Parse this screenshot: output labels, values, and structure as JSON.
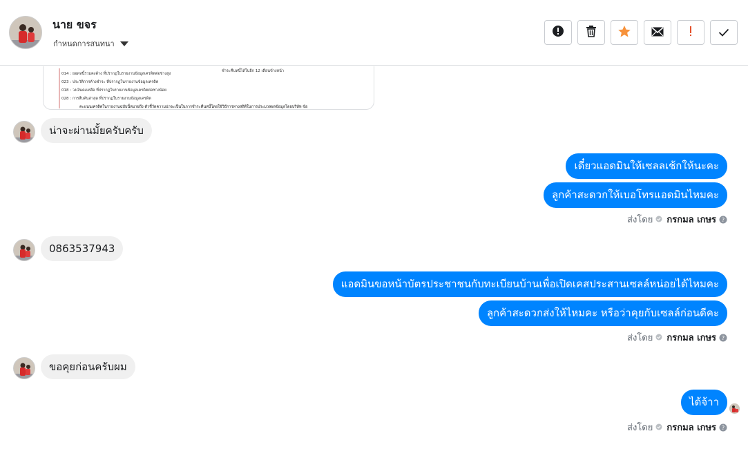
{
  "contact": {
    "name": "นาย ขจร",
    "assign_label": "กำหนดการสนทนา"
  },
  "toolbar": {
    "icons": [
      "alert-icon",
      "trash-icon",
      "star-icon",
      "mail-icon",
      "exclamation-icon",
      "check-icon"
    ],
    "star_color": "#f7923b",
    "exclamation_color": "#e4512b"
  },
  "colors": {
    "outgoing_bubble": "#0084ff",
    "incoming_bubble": "#f0f0f0"
  },
  "messages": {
    "in1": "น่าจะผ่านมั้ยครับครับ",
    "out1a": "เดี๋ยวแอดมินให้เซลลเช้กให้นะคะ",
    "out1b": "ลูกค้าสะดวกให้เบอโทรแอดมินไหมคะ",
    "in2": "0863537943",
    "out2a": "แอดมินขอหน้าบัตรประชาชนกับทะเบียนบ้านเพื่อเปิดเคสประสานเซลล์หน่อยได้ไหมคะ",
    "out2b": "ลูกค้าสะดวกส่งให้ไหมคะ  หรือว่าคุยกับเซลล์ก่อนดีคะ",
    "in3": "ขอคุยก่อนครับผม",
    "out3": "ได้จ้าา"
  },
  "sent_by": {
    "label": "ส่งโดย",
    "sender": "กรกมล เกษร"
  },
  "attachment": {
    "lines": [
      "014 : ยอดหนี้รวมคงค้าง ที่ปรากฏในรายงานข้อมูลเครดิตต่อช่างสูง",
      "023 : ประวัติการค้างชำระ ที่ปรากฏในรายงานข้อมูลเครดิต",
      "018 : วงเงินคงเหลือ ที่ปรากฏในรายงานข้อมูลเครดิตต่อช่างน้อย",
      "028 : การสืบค้นล่าสุด ที่ปรากฏในรายงานข้อมูลเครดิต"
    ],
    "right_note": "ชำระคืนหนี้ได้ในอีก 12 เดือนข้างหน้า",
    "footer": "คะแนนเครดิตในรายงานฉบับนี้หมายถึง ตัวชี้วัดความน่าจะเป็นในการชำระคืนหนี้โดยใช้วิธีการทางสถิติในการประมวลผลข้อมูลโดยบริษัท ข้อ"
  }
}
